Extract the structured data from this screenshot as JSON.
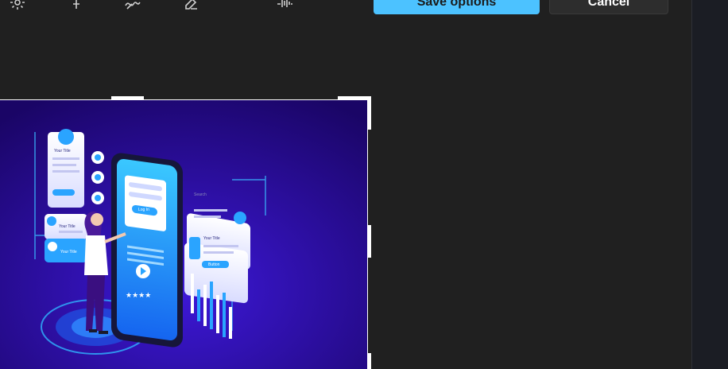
{
  "toolbar": {
    "tools": [
      {
        "name": "brightness-icon"
      },
      {
        "name": "pin-icon"
      },
      {
        "name": "draw-icon"
      },
      {
        "name": "erase-icon"
      },
      {
        "name": "adjust-icon"
      }
    ],
    "save_label": "Save options",
    "cancel_label": "Cancel"
  },
  "illustration": {
    "card_title_1": "Your Title",
    "card_title_2": "Your Title",
    "card_title_3": "Your Title",
    "card_title_4": "Your Title",
    "phone_button": "Log In",
    "search_placeholder": "Search",
    "card_button": "Button"
  },
  "colors": {
    "accent": "#4cc2ff",
    "background": "#202020",
    "image_bg": "#2a0a8a"
  }
}
